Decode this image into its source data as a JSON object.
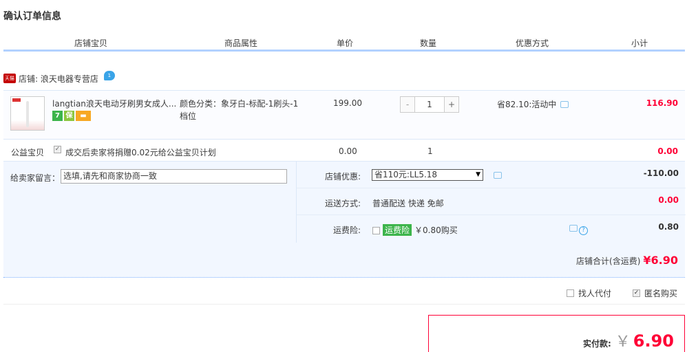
{
  "page_title": "确认订单信息",
  "columns": [
    "店铺宝贝",
    "商品属性",
    "单价",
    "数量",
    "优惠方式",
    "小计"
  ],
  "shop": {
    "tmall_icon": "天猫",
    "label": "店铺: 浪天电器专营店",
    "chat_icon": "wangwang-icon"
  },
  "item": {
    "title": "langtian浪天电动牙刷男女成人...",
    "attribute": "颜色分类：象牙白-标配-1刷头-1档位",
    "price": "199.00",
    "quantity": "1",
    "minus": "-",
    "plus": "+",
    "promo": "省82.10:活动中",
    "subtotal": "116.90",
    "badges": [
      "7",
      "保"
    ]
  },
  "charity": {
    "label": "公益宝贝",
    "text": "成交后卖家将捐赠0.02元给公益宝贝计划",
    "price": "0.00",
    "quantity": "1",
    "subtotal": "0.00"
  },
  "message": {
    "label": "给卖家留言：",
    "placeholder": "选填,请先和商家协商一致"
  },
  "shop_discount": {
    "label": "店铺优惠:",
    "selected": "省110元:LL5.18",
    "amount": "-110.00"
  },
  "shipping": {
    "label": "运送方式:",
    "value": "普通配送 快递 免邮",
    "amount": "0.00"
  },
  "freight_insurance": {
    "label": "运费险:",
    "tag": "运费险",
    "value": "￥0.80购买",
    "amount": "0.80"
  },
  "shop_total": {
    "label": "店铺合计(含运费)",
    "amount": "¥6.90"
  },
  "options": {
    "proxy_pay": "找人代付",
    "anonymous": "匿名购买"
  },
  "payment": {
    "label": "实付款:",
    "currency": "￥",
    "amount": "6.90"
  },
  "colors": {
    "accent_red": "#ff0036",
    "header_border": "#b2d1ff",
    "panel_bg": "#f2f7ff"
  }
}
